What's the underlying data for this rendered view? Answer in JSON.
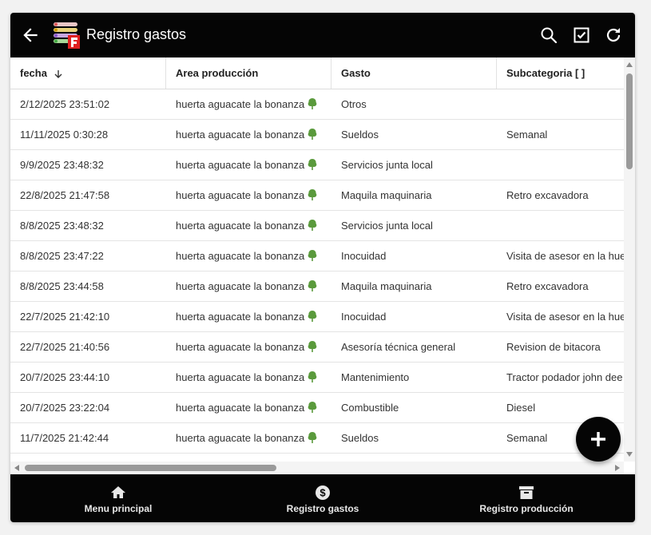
{
  "appbar": {
    "title": "Registro gastos"
  },
  "table": {
    "columns": [
      {
        "label": "fecha"
      },
      {
        "label": "Area producción"
      },
      {
        "label": "Gasto"
      },
      {
        "label": "Subcategoria [ ]"
      }
    ],
    "rows": [
      {
        "fecha": "2/12/2025 23:51:02",
        "area": "huerta aguacate la bonanza",
        "gasto": "Otros",
        "sub": ""
      },
      {
        "fecha": "11/11/2025 0:30:28",
        "area": "huerta aguacate la bonanza",
        "gasto": "Sueldos",
        "sub": "Semanal"
      },
      {
        "fecha": "9/9/2025 23:48:32",
        "area": "huerta aguacate la bonanza",
        "gasto": "Servicios junta local",
        "sub": ""
      },
      {
        "fecha": "22/8/2025 21:47:58",
        "area": "huerta aguacate la bonanza",
        "gasto": "Maquila maquinaria",
        "sub": "Retro excavadora"
      },
      {
        "fecha": "8/8/2025 23:48:32",
        "area": "huerta aguacate la bonanza",
        "gasto": "Servicios junta local",
        "sub": ""
      },
      {
        "fecha": "8/8/2025 23:47:22",
        "area": "huerta aguacate la bonanza",
        "gasto": "Inocuidad",
        "sub": "Visita de asesor en la hue"
      },
      {
        "fecha": "8/8/2025 23:44:58",
        "area": "huerta aguacate la bonanza",
        "gasto": "Maquila maquinaria",
        "sub": "Retro excavadora"
      },
      {
        "fecha": "22/7/2025 21:42:10",
        "area": "huerta aguacate la bonanza",
        "gasto": "Inocuidad",
        "sub": "Visita de asesor en la hue"
      },
      {
        "fecha": "22/7/2025 21:40:56",
        "area": "huerta aguacate la bonanza",
        "gasto": "Asesoría técnica general",
        "sub": "Revision de bitacora"
      },
      {
        "fecha": "20/7/2025 23:44:10",
        "area": "huerta aguacate la bonanza",
        "gasto": "Mantenimiento",
        "sub": "Tractor podador john dee"
      },
      {
        "fecha": "20/7/2025 23:22:04",
        "area": "huerta aguacate la bonanza",
        "gasto": "Combustible",
        "sub": "Diesel"
      },
      {
        "fecha": "11/7/2025 21:42:44",
        "area": "huerta aguacate la bonanza",
        "gasto": "Sueldos",
        "sub": "Semanal"
      }
    ]
  },
  "nav": {
    "items": [
      {
        "label": "Menu principal",
        "icon": "home-icon"
      },
      {
        "label": "Registro gastos",
        "icon": "dollar-coin-icon"
      },
      {
        "label": "Registro producción",
        "icon": "archive-box-icon"
      }
    ]
  },
  "colors": {
    "bar": "#050505",
    "tree": "#5a9a3c"
  }
}
